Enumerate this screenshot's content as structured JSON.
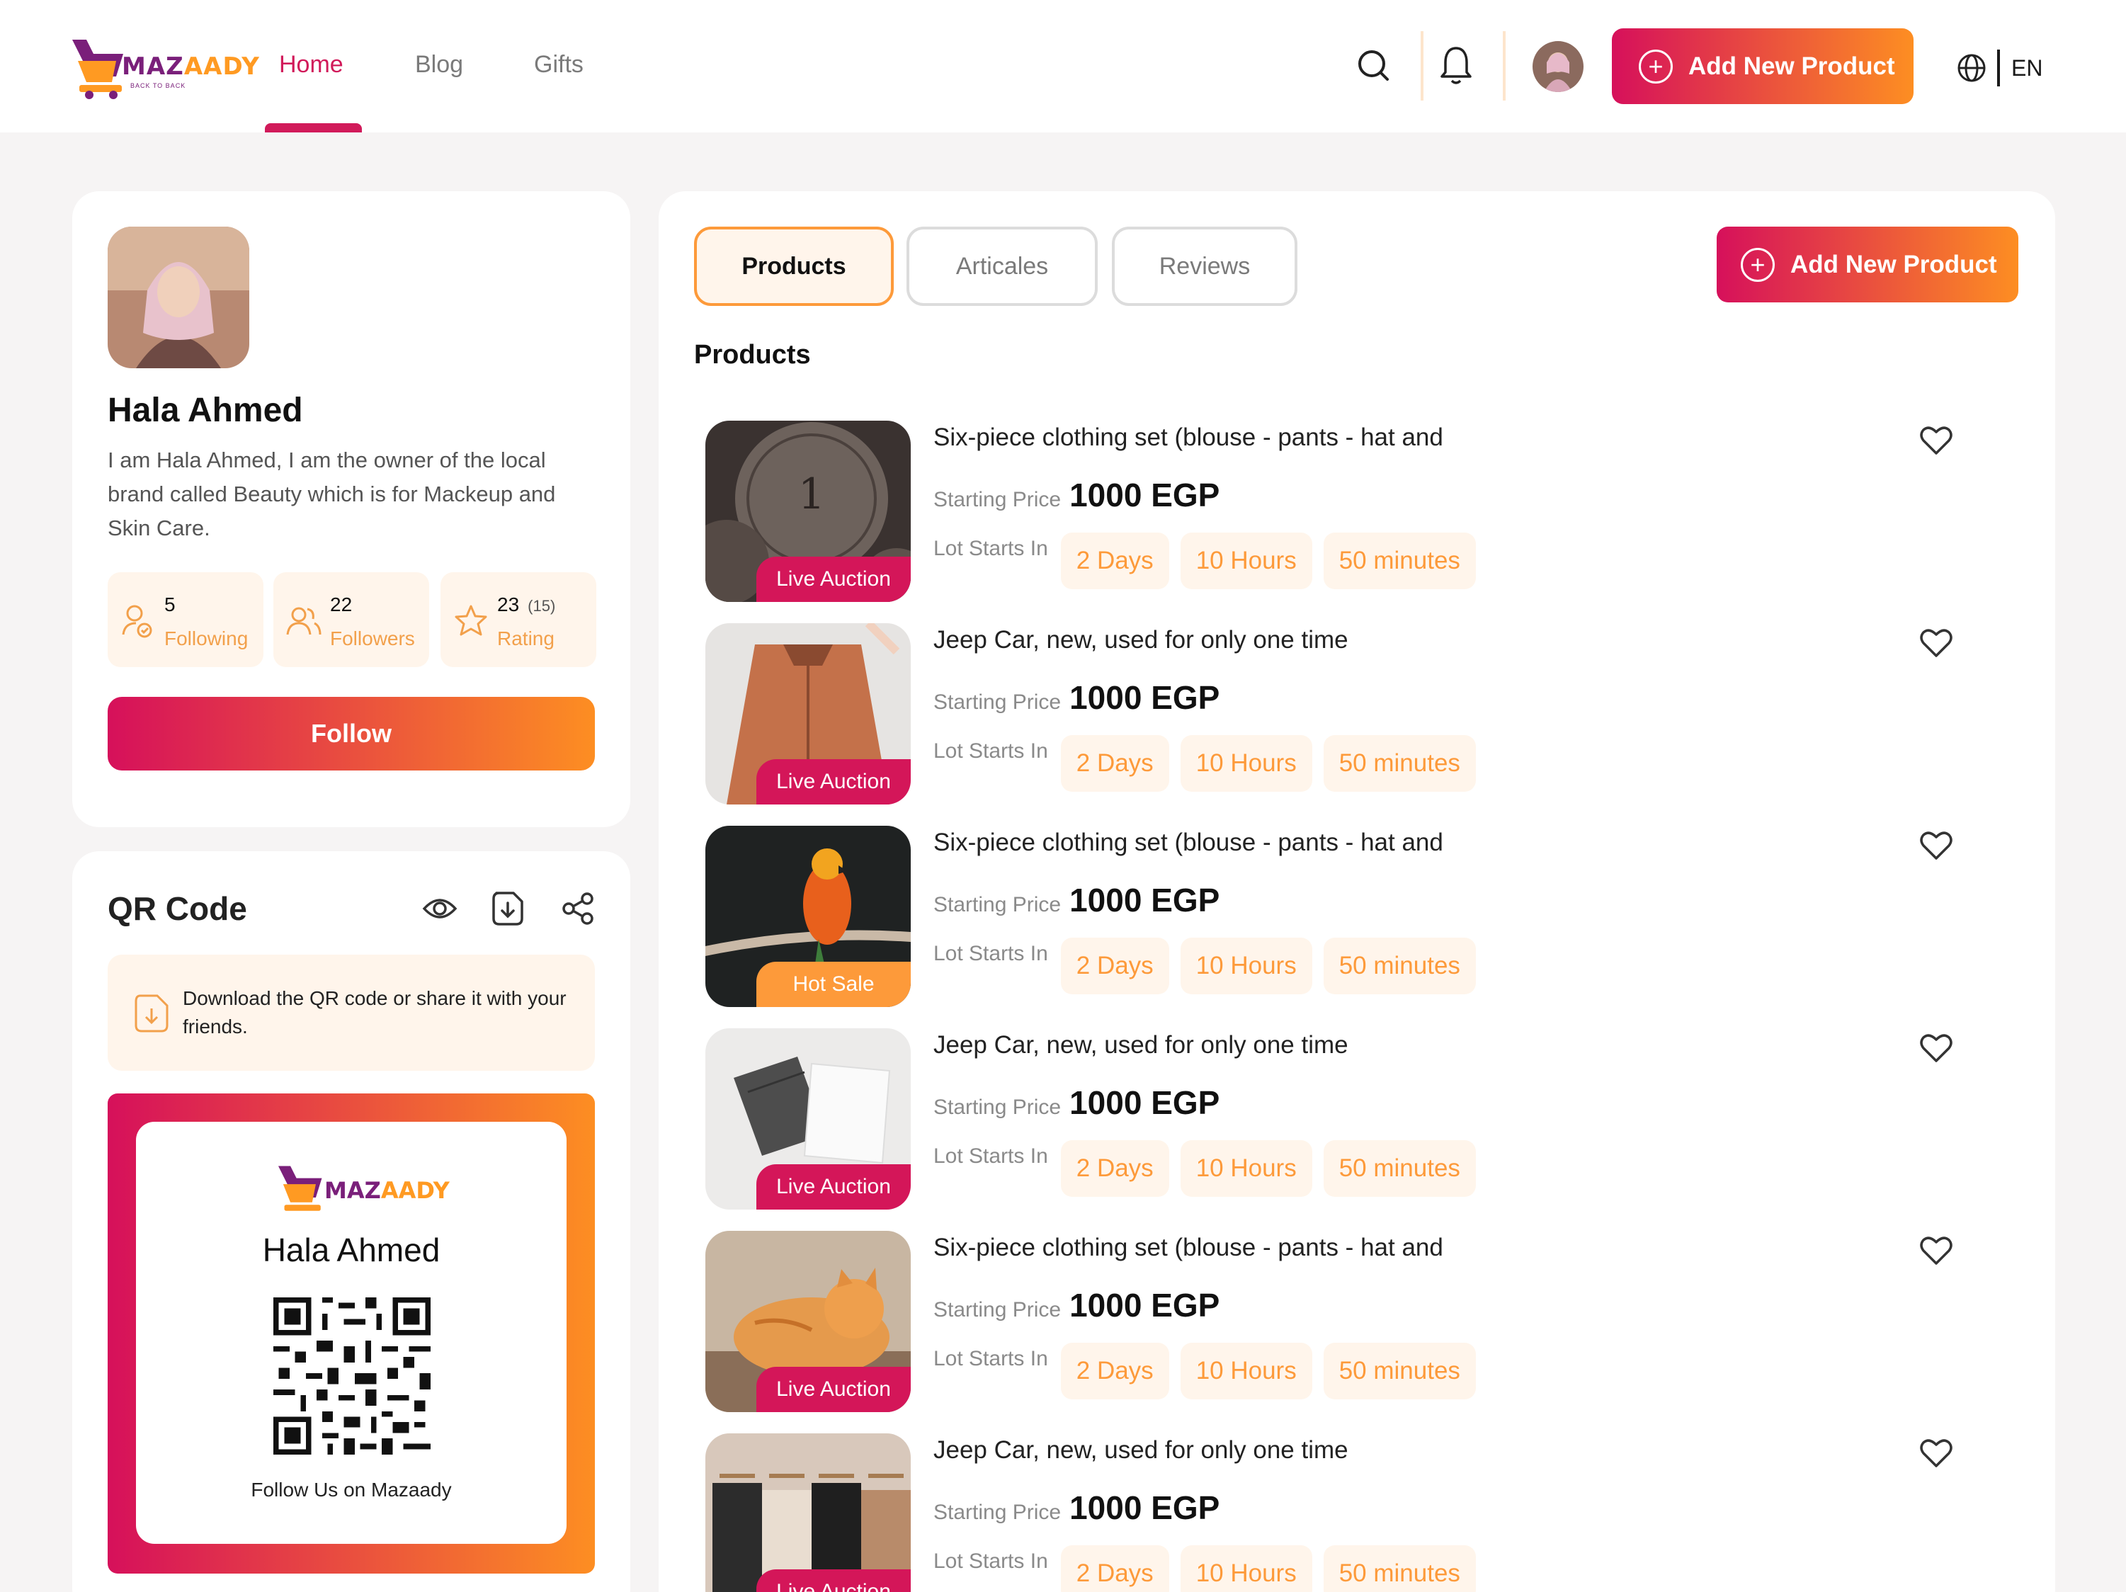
{
  "colors": {
    "primary": "#d6105b",
    "secondary": "#fd8e22",
    "chip_bg": "#fff5eb",
    "chip_text": "#fd9a3a",
    "badge": "#d41659"
  },
  "header": {
    "logo_text_a": "MAZ",
    "logo_text_b": "AADY",
    "logo_sub": "BACK TO BACK",
    "nav": [
      "Home",
      "Blog",
      "Gifts"
    ],
    "add_product_label": "Add New Product",
    "language": "EN",
    "icons": [
      "search-icon",
      "bell-icon",
      "globe-icon",
      "plus-circle-icon"
    ]
  },
  "profile": {
    "name": "Hala Ahmed",
    "bio": "I am Hala Ahmed, I am the owner of the local brand called Beauty which is for Mackeup and Skin Care.",
    "stats": [
      {
        "value": "5",
        "label": "Following",
        "icon": "user-check-icon"
      },
      {
        "value": "22",
        "label": "Followers",
        "icon": "users-icon"
      },
      {
        "value": "23",
        "extra": "(15)",
        "label": "Rating",
        "icon": "star-icon"
      }
    ],
    "follow_label": "Follow"
  },
  "qr": {
    "title": "QR Code",
    "info": "Download the QR code or share it with your friends.",
    "card_name": "Hala Ahmed",
    "card_footer": "Follow Us on Mazaady",
    "actions": [
      "eye-icon",
      "download-icon",
      "share-icon"
    ]
  },
  "main": {
    "tabs": [
      "Products",
      "Articales",
      "Reviews"
    ],
    "active_tab": "Products",
    "add_product_label": "Add New Product",
    "section_title": "Products",
    "price_label": "Starting Price",
    "lot_label": "Lot Starts In",
    "products": [
      {
        "title": "Six-piece clothing set (blouse - pants - hat and",
        "price": "1000 EGP",
        "badge": "Live Auction",
        "days": "2 Days",
        "hours": "10 Hours",
        "minutes": "50 minutes",
        "image": "coins"
      },
      {
        "title": "Jeep Car, new, used for only one time",
        "price": "1000 EGP",
        "badge": "Live Auction",
        "days": "2 Days",
        "hours": "10 Hours",
        "minutes": "50 minutes",
        "image": "jacket"
      },
      {
        "title": "Six-piece clothing set (blouse - pants - hat and",
        "price": "1000 EGP",
        "badge": "Hot Sale",
        "days": "2 Days",
        "hours": "10 Hours",
        "minutes": "50 minutes",
        "image": "parrot"
      },
      {
        "title": "Jeep Car, new, used for only one time",
        "price": "1000 EGP",
        "badge": "Live Auction",
        "days": "2 Days",
        "hours": "10 Hours",
        "minutes": "50 minutes",
        "image": "clothes"
      },
      {
        "title": "Six-piece clothing set (blouse - pants - hat and",
        "price": "1000 EGP",
        "badge": "Live Auction",
        "days": "2 Days",
        "hours": "10 Hours",
        "minutes": "50 minutes",
        "image": "cat"
      },
      {
        "title": "Jeep Car, new, used for only one time",
        "price": "1000 EGP",
        "badge": "Live Auction",
        "days": "2 Days",
        "hours": "10 Hours",
        "minutes": "50 minutes",
        "image": "hangers"
      }
    ]
  }
}
